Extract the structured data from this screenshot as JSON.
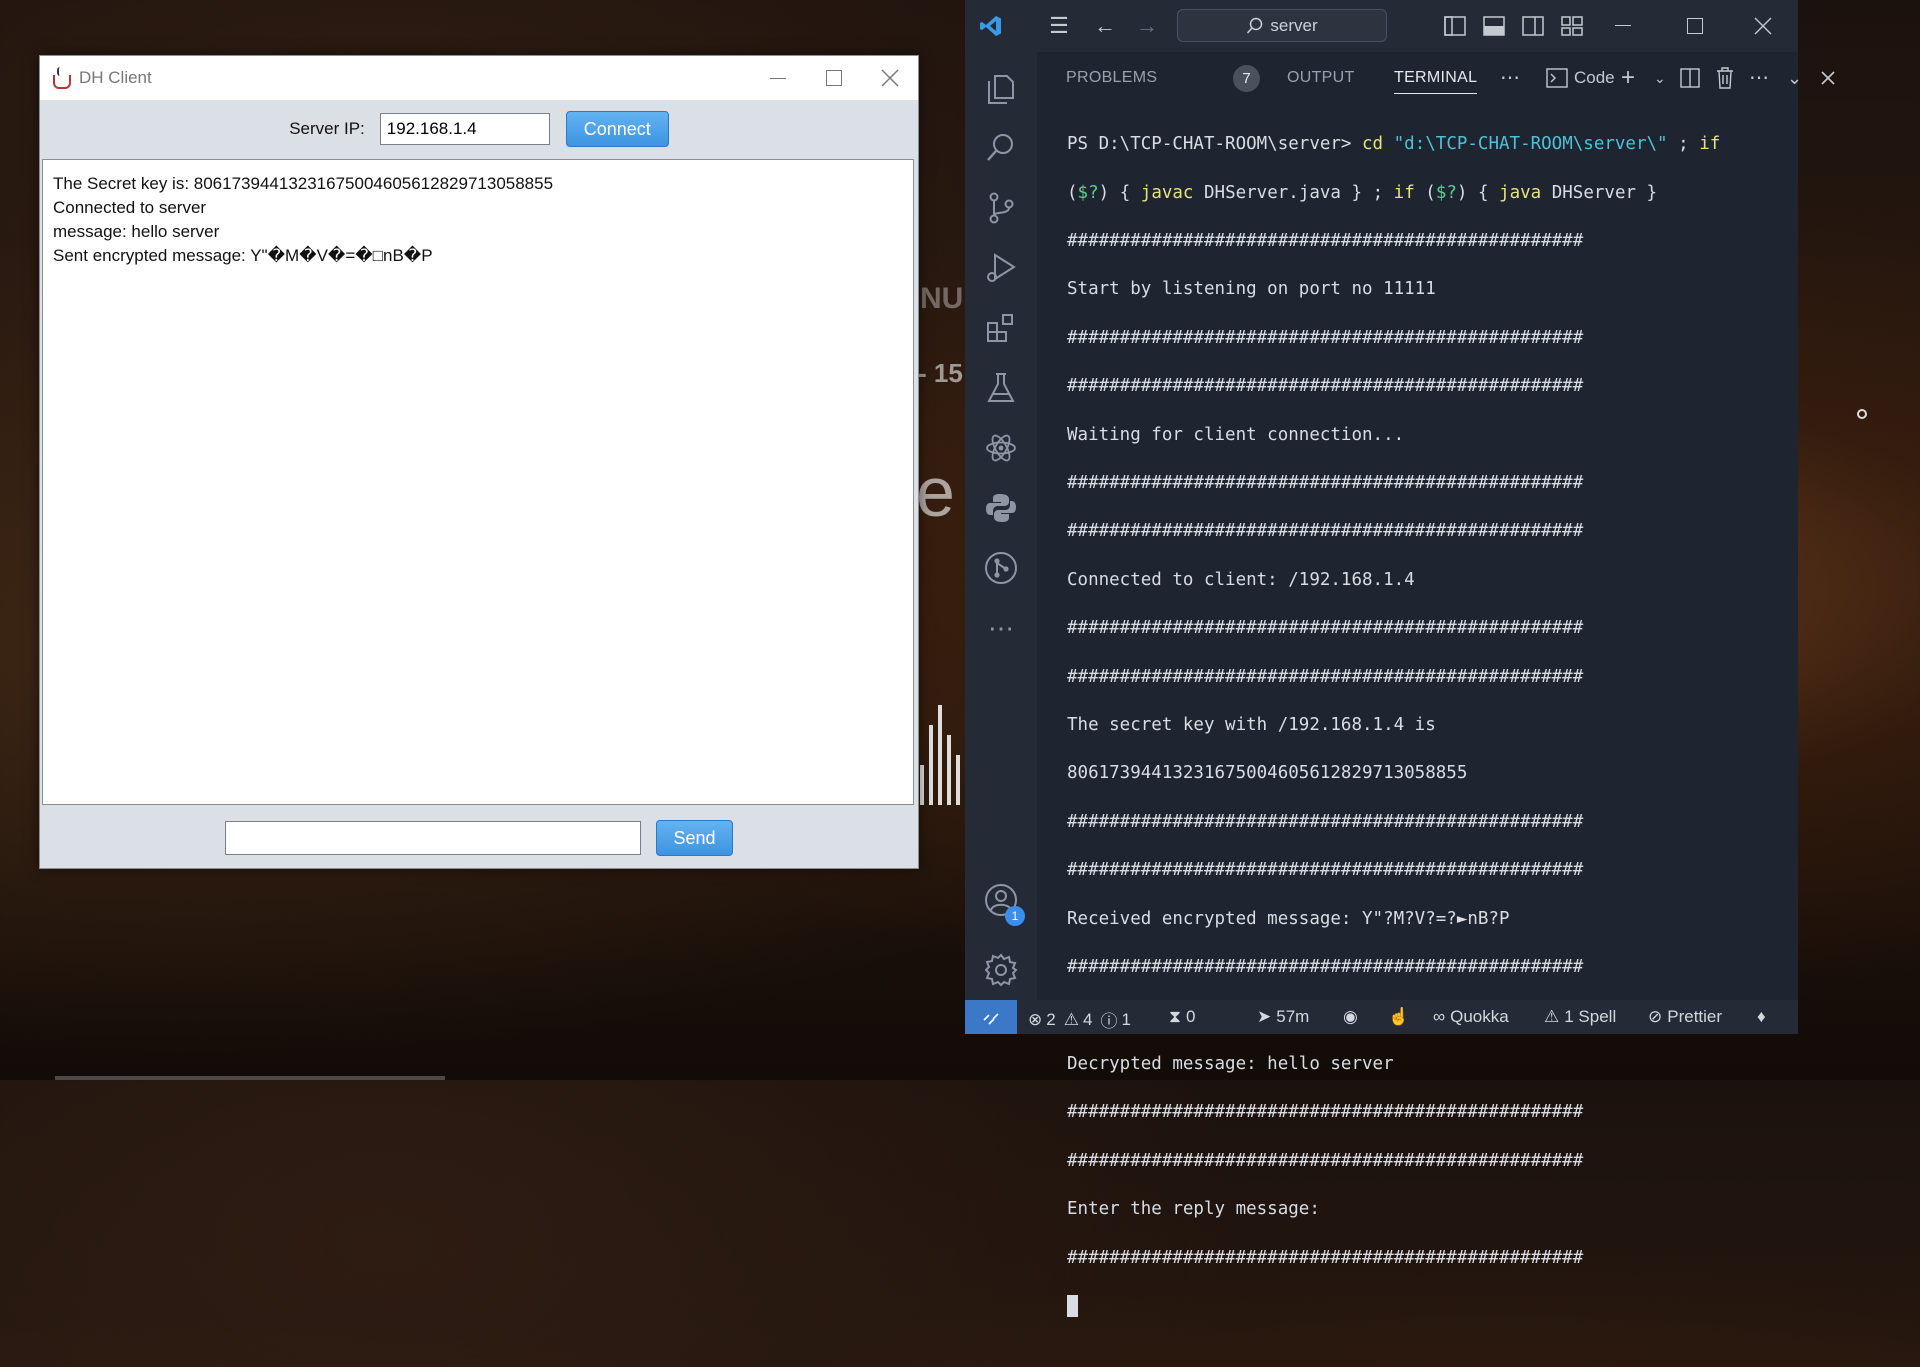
{
  "dh_client": {
    "title": "DH Client",
    "server_ip_label": "Server IP:",
    "server_ip_value": "192.168.1.4",
    "connect_label": "Connect",
    "log_lines": [
      "The Secret key is: 8061739441323167500460561282971305885​5",
      "Connected to server",
      "message: hello server",
      "Sent encrypted message: Y\"�M�V�=�□nB�P"
    ],
    "message_value": "",
    "send_label": "Send"
  },
  "vscode": {
    "search_text": "server",
    "tabs": {
      "problems": "PROBLEMS",
      "problems_count": "7",
      "output": "OUTPUT",
      "terminal": "TERMINAL"
    },
    "terminal_profile": "Code",
    "account_badge": "1",
    "terminal": {
      "prompt": "PS D:\\TCP-CHAT-ROOM\\server> ",
      "cmd_cd": "cd",
      "cmd_path": "\"d:\\TCP-CHAT-ROOM\\server\\\"",
      "cmd_sep1": " ; ",
      "cmd_if1": "if",
      "cmd_wrap_open": "(",
      "cmd_q1": "$?",
      "cmd_wrap_mid": ") { ",
      "cmd_javac": "javac",
      "cmd_javac_arg": " DHServer.java } ; ",
      "cmd_if2": "if",
      "cmd_paren2": " (",
      "cmd_q2": "$?",
      "cmd_paren2_close": ") { ",
      "cmd_java": "java",
      "cmd_java_arg": " DHServer }",
      "lines": [
        "#################################################",
        "Start by listening on port no 11111",
        "#################################################",
        "#################################################",
        "Waiting for client connection...",
        "#################################################",
        "#################################################",
        "Connected to client: /192.168.1.4",
        "#################################################",
        "#################################################",
        "The secret key with /192.168.1.4 is",
        "80617394413231675004605612829713058855",
        "#################################################",
        "#################################################",
        "Received encrypted message: Y\"?M?V?=?►nB?P",
        "#################################################",
        "#################################################",
        "Decrypted message: hello server",
        "#################################################",
        "#################################################",
        "Enter the reply message:",
        "#################################################"
      ]
    },
    "statusbar": {
      "errors": "2",
      "warnings": "4",
      "infos": "1",
      "ports": "0",
      "time": "57m",
      "quokka": "Quokka",
      "spell": "1 Spell",
      "prettier": "Prettier"
    }
  },
  "wallpaper": {
    "fragment_1": "NU",
    "fragment_2": "- 15",
    "fragment_3": "e"
  }
}
